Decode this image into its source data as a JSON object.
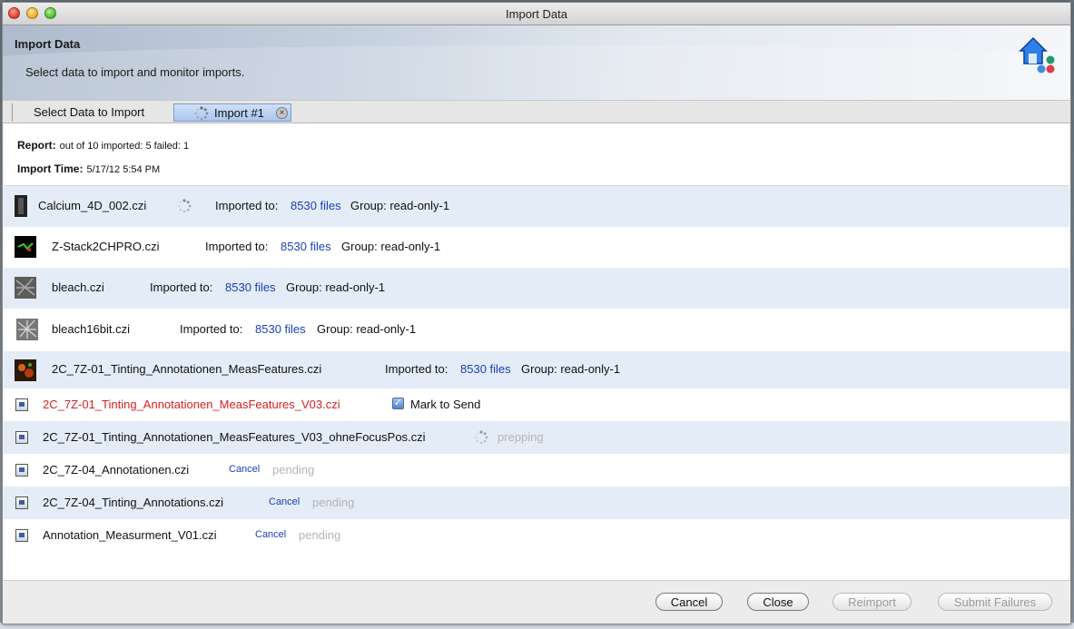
{
  "window": {
    "title": "Import Data"
  },
  "banner": {
    "title": "Import Data",
    "subtitle": "Select data to import and monitor imports."
  },
  "tabs": [
    {
      "label": "Select Data to Import"
    },
    {
      "label": "Import #1"
    }
  ],
  "report": {
    "report_label": "Report:",
    "report_value": "out of 10 imported: 5 failed: 1",
    "time_label": "Import Time:",
    "time_value": "5/17/12 5:54 PM"
  },
  "imported_label": "Imported to:",
  "files_link": "8530 files",
  "group_label": "Group: read-only-1",
  "mark_to_send": "Mark to Send",
  "cancel_label": "Cancel",
  "files": [
    {
      "name": "Calcium_4D_002.czi",
      "status": "imported"
    },
    {
      "name": "Z-Stack2CHPRO.czi",
      "status": "imported"
    },
    {
      "name": "bleach.czi",
      "status": "imported"
    },
    {
      "name": "bleach16bit.czi",
      "status": "imported"
    },
    {
      "name": "2C_7Z-01_Tinting_Annotationen_MeasFeatures.czi",
      "status": "imported"
    },
    {
      "name": "2C_7Z-01_Tinting_Annotationen_MeasFeatures_V03.czi",
      "status": "failed"
    },
    {
      "name": "2C_7Z-01_Tinting_Annotationen_MeasFeatures_V03_ohneFocusPos.czi",
      "status": "prepping"
    },
    {
      "name": "2C_7Z-04_Annotationen.czi",
      "status": "pending"
    },
    {
      "name": "2C_7Z-04_Tinting_Annotations.czi",
      "status": "pending"
    },
    {
      "name": "Annotation_Measurment_V01.czi",
      "status": "pending"
    }
  ],
  "buttons": {
    "cancel": "Cancel",
    "close": "Close",
    "reimport": "Reimport",
    "submit_failures": "Submit Failures"
  }
}
